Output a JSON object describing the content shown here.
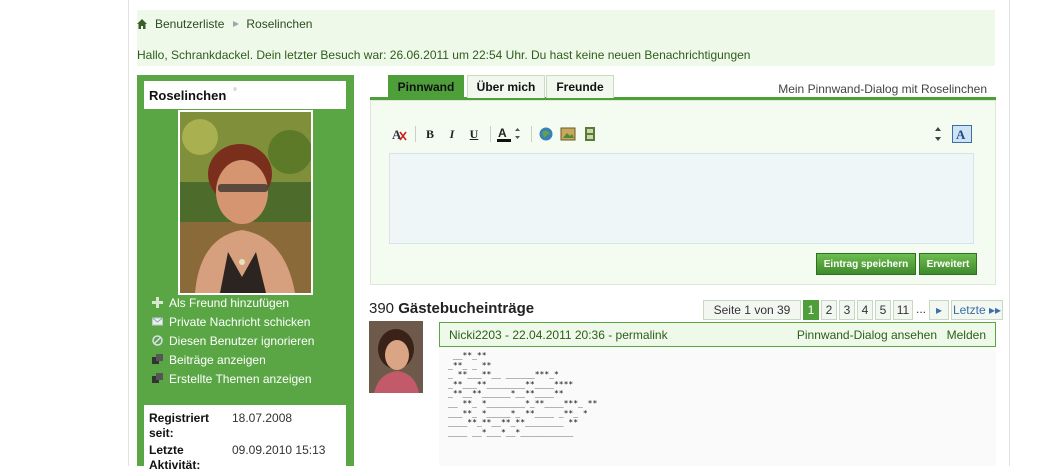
{
  "breadcrumb": {
    "items": [
      "Benutzerliste",
      "Roselinchen"
    ]
  },
  "welcome": "Hallo, Schrankdackel. Dein letzter Besuch war: 26.06.2011 um 22:54 Uhr. Du hast keine neuen Benachrichtigungen",
  "profile": {
    "name": "Roselinchen",
    "status_dot": "°",
    "actions": [
      {
        "label": "Als Freund hinzufügen",
        "icon": "plus-icon"
      },
      {
        "label": "Private Nachricht schicken",
        "icon": "envelope-icon"
      },
      {
        "label": "Diesen Benutzer ignorieren",
        "icon": "block-icon"
      },
      {
        "label": "Beiträge anzeigen",
        "icon": "posts-icon"
      },
      {
        "label": "Erstellte Themen anzeigen",
        "icon": "threads-icon"
      }
    ],
    "stats": {
      "registered_label": "Registriert seit:",
      "registered_value": "18.07.2008",
      "last_activity_label": "Letzte Aktivität:",
      "last_activity_value": "09.09.2010 15:13"
    }
  },
  "tabs": [
    {
      "label": "Pinnwand",
      "active": true
    },
    {
      "label": "Über mich",
      "active": false
    },
    {
      "label": "Freunde",
      "active": false
    }
  ],
  "dialog_link": "Mein Pinnwand-Dialog mit Roselinchen",
  "editor": {
    "save_label": "Eintrag speichern",
    "advanced_label": "Erweitert"
  },
  "guestbook": {
    "count": "390",
    "title": "Gästebucheinträge"
  },
  "pagination": {
    "summary": "Seite 1 von 39",
    "pages": [
      "1",
      "2",
      "3",
      "4",
      "5",
      "11"
    ],
    "current": "1",
    "ellipsis": "...",
    "next": "▸",
    "last": "Letzte ▸▸"
  },
  "entry": {
    "meta": "Nicki2203 - 22.04.2011   20:36 - permalink",
    "view_dialog": "Pinnwand-Dialog ansehen",
    "report": "Melden",
    "art": " __**_**\n_**_ _ **\n_ **___**__ ______***_*\n_**___**________**____****\n_**__**______*__**____**\n__ **_ *________*_**____***_ **\n___**_ *_____*_ **____ _**_ *\n____**_**__**_**________ **\n____ __*___*__*___________"
  },
  "colors": {
    "accent": "#4e9e3a",
    "sidebar": "#5aa645",
    "notice_bg": "#eef9e9"
  }
}
